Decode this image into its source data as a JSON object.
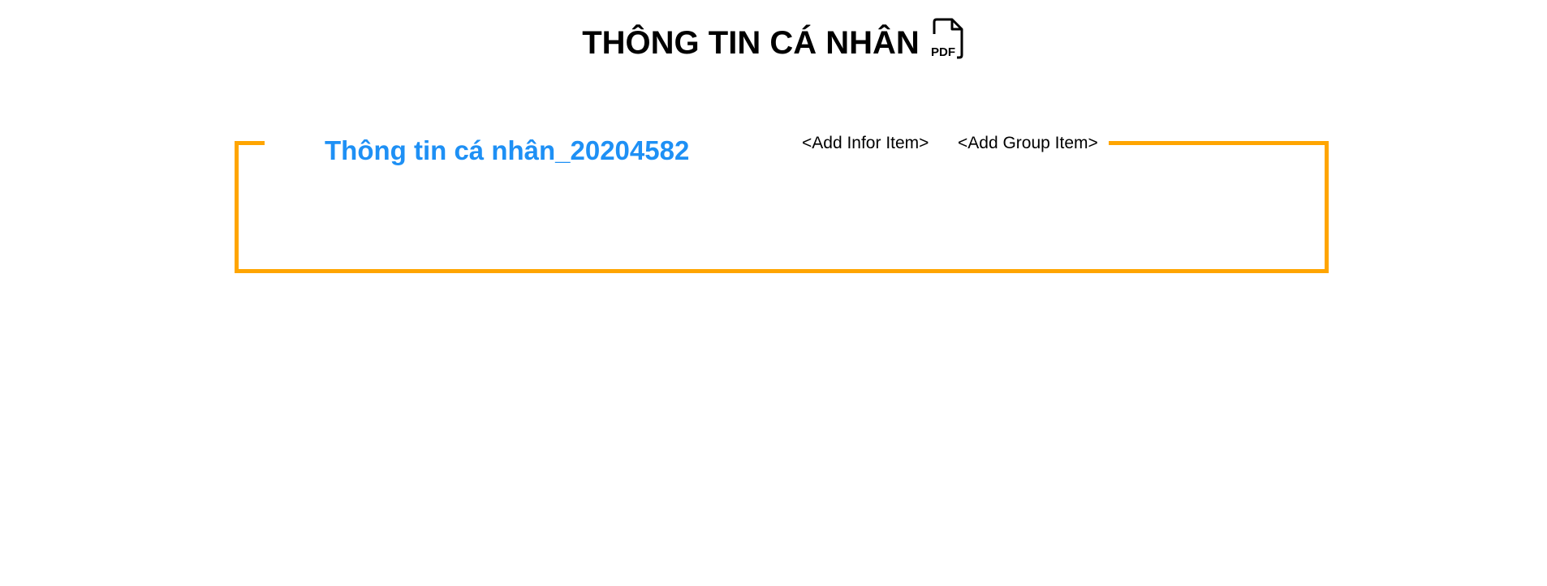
{
  "header": {
    "title": "THÔNG TIN CÁ NHÂN",
    "pdf_icon": "pdf-file-icon",
    "pdf_icon_text": "PDF"
  },
  "group": {
    "title": "Thông tin cá nhân_20204582",
    "add_infor_label": "<Add Infor Item>",
    "add_group_label": "<Add Group Item>"
  },
  "colors": {
    "frame": "#FFA500",
    "group_title": "#1E90F5",
    "text": "#000000",
    "background": "#FFFFFF"
  }
}
